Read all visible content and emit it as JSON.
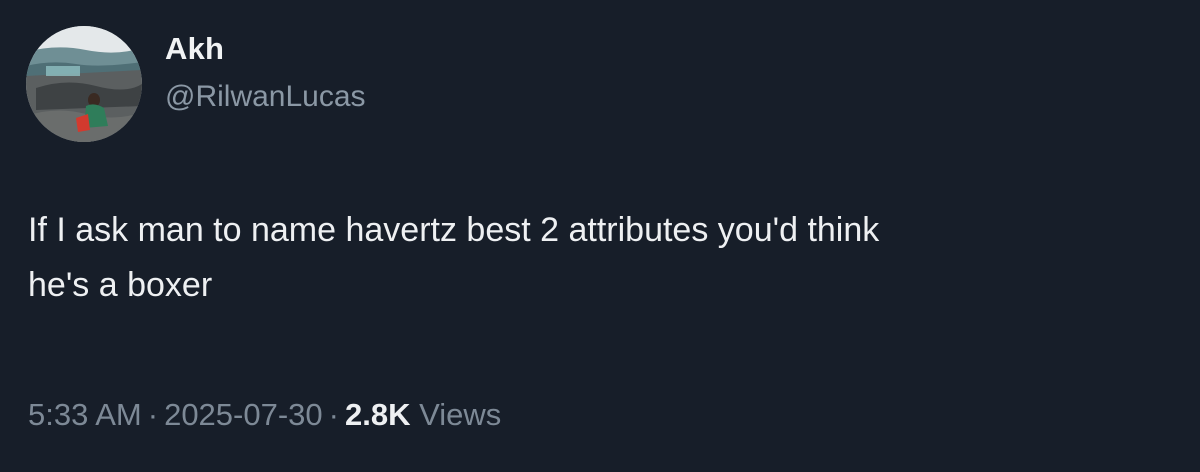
{
  "author": {
    "display_name": "Akh",
    "handle": "@RilwanLucas",
    "avatar_icon": "profile-photo"
  },
  "tweet": {
    "text": "If I ask man to name havertz best 2 attributes you'd think\nhe's a boxer"
  },
  "meta": {
    "time": "5:33 AM",
    "date": "2025-07-30",
    "separator": "·",
    "views_count": "2.8K",
    "views_label": "Views"
  },
  "colors": {
    "background": "#171e29",
    "primary_text": "#e7e9ea",
    "secondary_text": "#8b98a5"
  }
}
